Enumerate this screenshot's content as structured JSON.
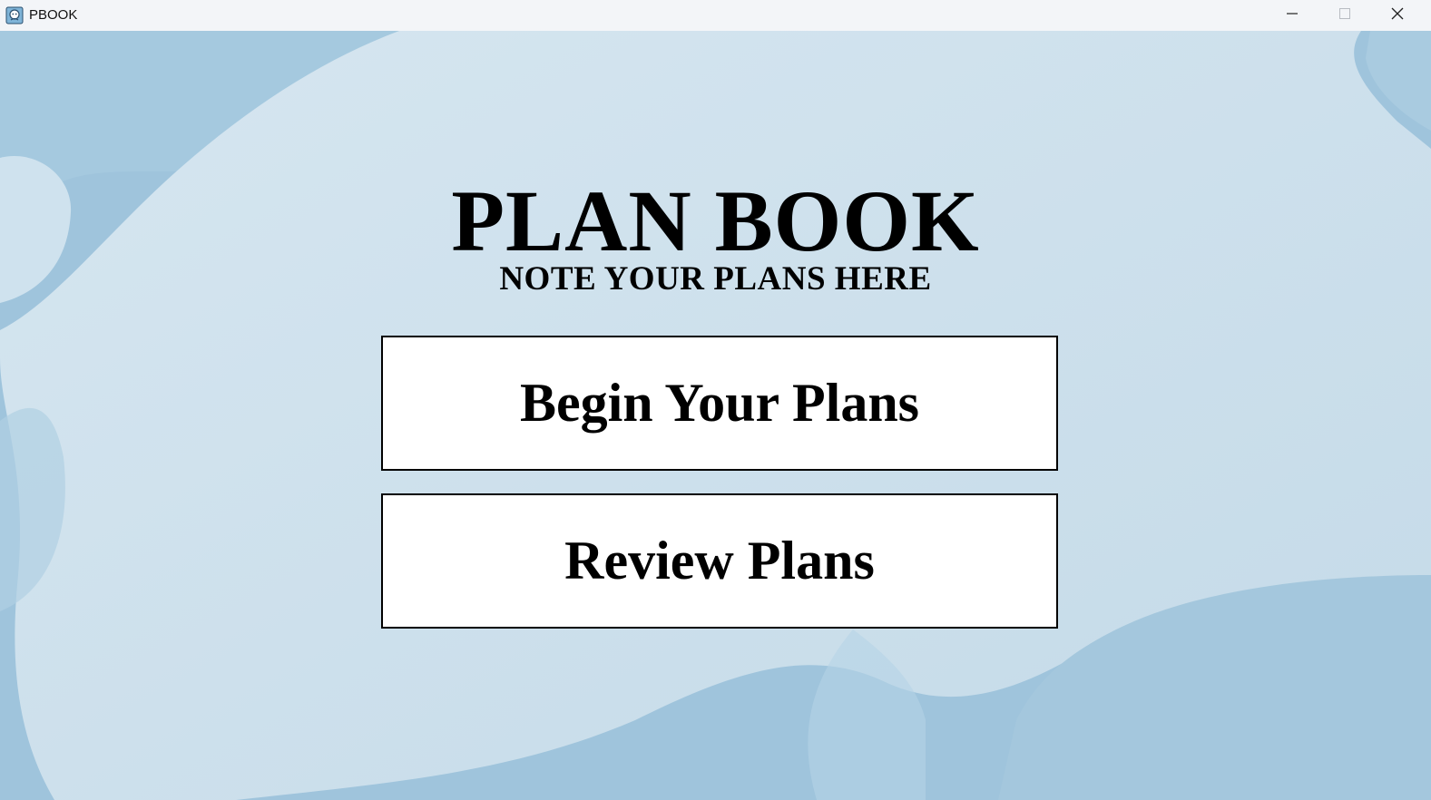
{
  "window": {
    "title": "PBOOK",
    "icon": "app-book-icon",
    "controls": {
      "minimize": "minimize-icon",
      "maximize": "maximize-icon",
      "close": "close-icon"
    }
  },
  "main": {
    "title": "PLAN BOOK",
    "subtitle": "NOTE YOUR PLANS HERE",
    "buttons": {
      "begin_label": "Begin Your Plans",
      "review_label": "Review Plans"
    }
  },
  "colors": {
    "background_light": "#cde0ec",
    "background_dark": "#9cc2db",
    "button_bg": "#ffffff",
    "text": "#000000"
  }
}
